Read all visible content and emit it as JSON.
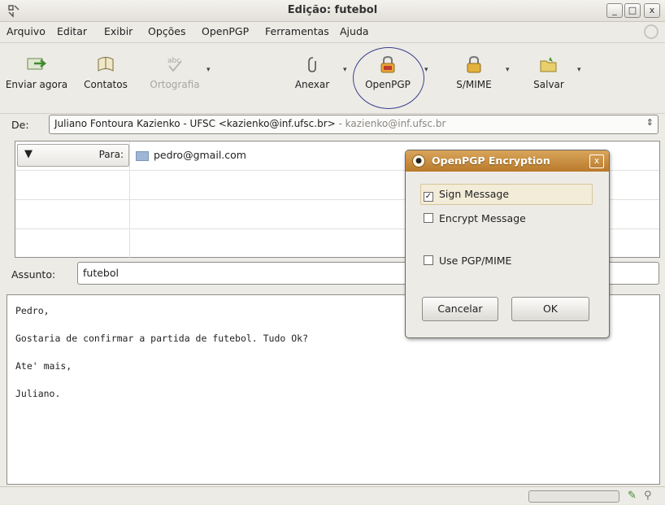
{
  "window": {
    "title": "Edição: futebol",
    "controls": {
      "minimize": "_",
      "maximize": "□",
      "close": "x"
    }
  },
  "menu": {
    "items": [
      {
        "label": "Arquivo"
      },
      {
        "label": "Editar"
      },
      {
        "label": "Exibir"
      },
      {
        "label": "Opções"
      },
      {
        "label": "OpenPGP"
      },
      {
        "label": "Ferramentas"
      },
      {
        "label": "Ajuda"
      }
    ]
  },
  "toolbar": {
    "send": "Enviar agora",
    "contacts": "Contatos",
    "spelling": "Ortografia",
    "spelling_icon_text": "abc",
    "attach": "Anexar",
    "openpgp": "OpenPGP",
    "smime": "S/MIME",
    "save": "Salvar"
  },
  "from": {
    "label": "De:",
    "value": "Juliano Fontoura Kazienko - UFSC <kazienko@inf.ufsc.br>",
    "account": "- kazienko@inf.ufsc.br"
  },
  "recipients": {
    "rows": [
      {
        "type": "Para:",
        "address": "pedro@gmail.com"
      },
      {
        "type": "",
        "address": ""
      },
      {
        "type": "",
        "address": ""
      },
      {
        "type": "",
        "address": ""
      }
    ]
  },
  "subject": {
    "label": "Assunto:",
    "value": "futebol"
  },
  "body": {
    "lines": [
      "Pedro,",
      "Gostaria de confirmar a partida de futebol. Tudo Ok?",
      "Ate' mais,",
      "Juliano."
    ]
  },
  "dialog": {
    "title": "OpenPGP Encryption",
    "close": "x",
    "sign": {
      "label": "Sign Message",
      "checked": true
    },
    "encrypt": {
      "label": "Encrypt Message",
      "checked": false
    },
    "pgpmime": {
      "label": "Use PGP/MIME",
      "checked": false
    },
    "cancel": "Cancelar",
    "ok": "OK"
  },
  "colors": {
    "dialog_title": "#c48a3a",
    "highlight_circle": "#3a3f8c"
  }
}
